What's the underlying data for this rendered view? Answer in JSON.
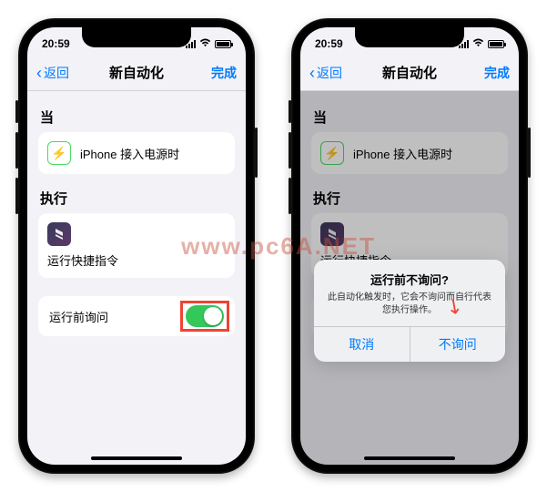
{
  "status": {
    "time": "20:59"
  },
  "nav": {
    "back": "返回",
    "title": "新自动化",
    "done": "完成"
  },
  "sections": {
    "when_label": "当",
    "when_item": "iPhone 接入电源时",
    "do_label": "执行",
    "do_item": "运行快捷指令"
  },
  "toggle": {
    "label": "运行前询问"
  },
  "alert": {
    "title": "运行前不询问?",
    "message": "此自动化触发时，它会不询问而自行代表您执行操作。",
    "cancel": "取消",
    "confirm": "不询问"
  },
  "watermark": "www.pc6A.NET"
}
